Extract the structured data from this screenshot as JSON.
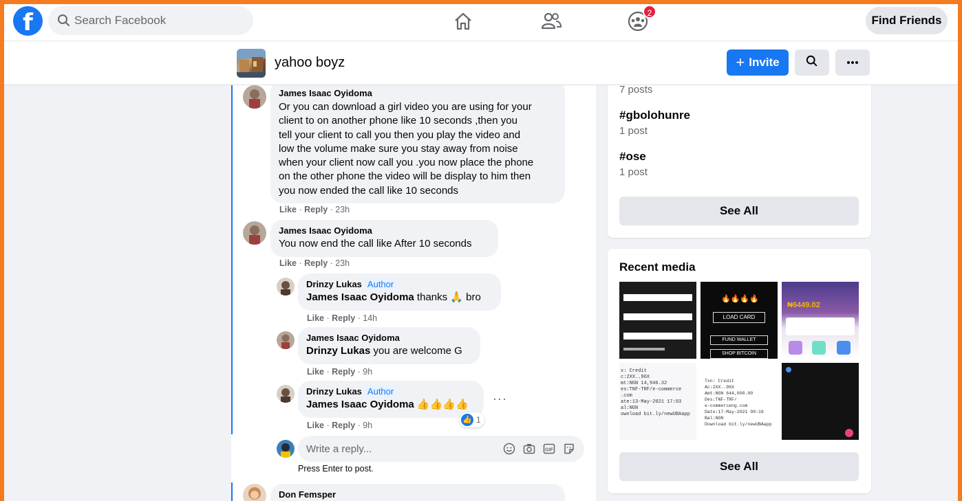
{
  "topbar": {
    "search_placeholder": "Search Facebook",
    "notification_count": "2",
    "find_friends_label": "Find Friends"
  },
  "group": {
    "name": "yahoo boyz",
    "invite_label": "Invite"
  },
  "comments": [
    {
      "author": "James Isaac Oyidoma",
      "lines": [
        "Or you can download a girl video you are using for your",
        "client to on another phone like 10 seconds ,then you",
        "tell your client to call you then you play the video and",
        "low the volume make sure you stay away from noise",
        "when your client now call you .you now place the phone",
        "on the other phone the video will be display to him then",
        "you now ended the call like 10 seconds"
      ],
      "like": "Like",
      "reply": "Reply",
      "time": "23h"
    },
    {
      "author": "James Isaac Oyidoma",
      "text": "You now end the call like After 10 seconds",
      "like": "Like",
      "reply": "Reply",
      "time": "23h"
    }
  ],
  "replies": [
    {
      "author": "Drinzy Lukas",
      "tag": "Author",
      "mention": "James Isaac Oyidoma",
      "text": " thanks 🙏 bro",
      "like": "Like",
      "reply": "Reply",
      "time": "14h"
    },
    {
      "author": "James Isaac Oyidoma",
      "mention": "Drinzy Lukas",
      "text": " you are welcome G",
      "like": "Like",
      "reply": "Reply",
      "time": "9h"
    },
    {
      "author": "Drinzy Lukas",
      "tag": "Author",
      "mention": "James Isaac Oyidoma",
      "text": " 👍👍👍👍",
      "like": "Like",
      "reply": "Reply",
      "time": "9h",
      "reaction_count": "1"
    }
  ],
  "reply_box": {
    "placeholder": "Write a reply...",
    "hint": "Press Enter to post."
  },
  "next_comment": {
    "author": "Don Femsper"
  },
  "hashtags_card": {
    "partial_count": "7 posts",
    "tags": [
      {
        "name": "#gbolohunre",
        "count": "1 post"
      },
      {
        "name": "#ose",
        "count": "1 post"
      }
    ],
    "see_all": "See All"
  },
  "recent_media": {
    "title": "Recent media",
    "see_all": "See All",
    "tile_texts": {
      "load_card": "LOAD CARD",
      "fund_wallet": "FUND WALLET",
      "shop_bitcoin": "SHOP BITCOIN",
      "balance": "₦6449.02",
      "receipt_a": [
        "x: Credit",
        "c:2XX..96X",
        "mt:NGN 14,946.32",
        "es:TNF-TRF/e-commerce",
        ".com",
        "ate:13-May-2021 17:03",
        "al:NGN",
        "ownload bit.ly/newUBAapp"
      ],
      "receipt_b": [
        "Txn: Credit",
        "Ac:2XX..96X",
        "Amt:NGN 644,000.00",
        "Des:TNF-TRF/",
        "e-commerceng.com",
        "Date:17-May-2021 00:19",
        "Bal:NGN",
        "Download bit.ly/newUBAapp"
      ]
    }
  }
}
